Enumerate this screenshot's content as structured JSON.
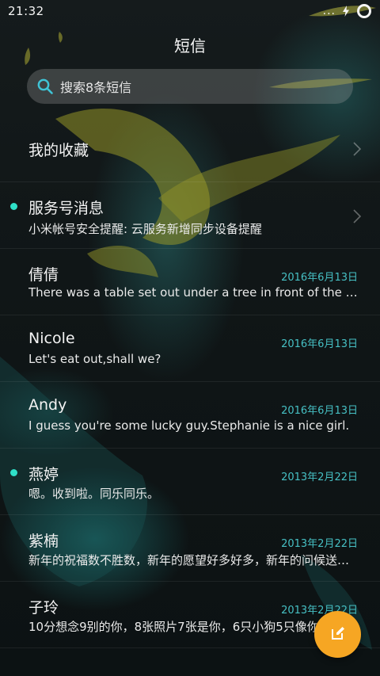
{
  "status_bar": {
    "time": "21:32",
    "dots": "...",
    "charging_icon": "bolt-icon",
    "signal_icon": "ring-icon"
  },
  "header": {
    "title": "短信"
  },
  "search": {
    "icon": "search-icon",
    "placeholder": "搜索8条短信"
  },
  "favorites": {
    "label": "我的收藏"
  },
  "service": {
    "title": "服务号消息",
    "subtitle": "小米帐号安全提醒: 云服务新增同步设备提醒",
    "unread": true
  },
  "conversations": [
    {
      "name": "倩倩",
      "date": "2016年6月13日",
      "preview": "There was a table set out under a tree in front of the house",
      "unread": false
    },
    {
      "name": "Nicole",
      "date": "2016年6月13日",
      "preview": "Let's eat out,shall we?",
      "unread": false
    },
    {
      "name": "Andy",
      "date": "2016年6月13日",
      "preview": "I guess you're some lucky guy.Stephanie is a nice girl.",
      "unread": false
    },
    {
      "name": "燕婷",
      "date": "2013年2月22日",
      "preview": "嗯。收到啦。同乐同乐。",
      "unread": true
    },
    {
      "name": "紫楠",
      "date": "2013年2月22日",
      "preview": "新年的祝福数不胜数，新年的愿望好多好多，新年的问候送给你",
      "unread": false
    },
    {
      "name": "子玲",
      "date": "2013年2月22日",
      "preview": "10分想念9别的你，8张照片7张是你，6只小狗5只像你",
      "unread": false
    }
  ],
  "fab": {
    "icon": "compose-icon"
  },
  "colors": {
    "accent": "#46c0c4",
    "unread_dot": "#2fe0c8",
    "fab": "#f6a623"
  }
}
